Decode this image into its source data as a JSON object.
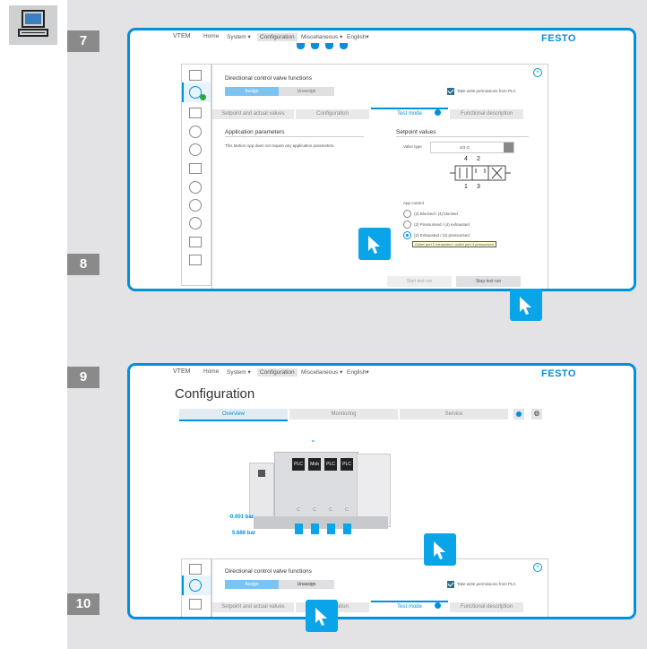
{
  "steps": [
    "7",
    "8",
    "9",
    "10"
  ],
  "nav": {
    "app_title": "VTEM",
    "items": [
      "Home",
      "System ▾",
      "Configuration",
      "Miscellaneous ▾",
      "English▾"
    ],
    "brand": "FESTO"
  },
  "panel": {
    "title": "Directional control valve functions",
    "seg_left": "Assign",
    "seg_right": "Unassign",
    "permissions": "Take write permissions from PLC",
    "tabs": [
      "Setpoint and actual values",
      "Configuration",
      "Test mode",
      "Functional description"
    ],
    "app_params_title": "Application parameters",
    "app_params_text": "This Motion App does not require any application parameters.",
    "setpoint_title": "Setpoint values",
    "valve_type_label": "Valve type",
    "valve_type_value": "4/3 G",
    "port_labels": [
      "4",
      "2",
      "1",
      "3"
    ],
    "app_control_label": "App control",
    "options": [
      "(2) Blocked / (4) blocked",
      "(2) Pressurised / (4) exhausted",
      "(2) Exhausted / (4) pressurised"
    ],
    "tooltip": "Outlet port 2 exhausted / outlet port 4 pressurised",
    "start_btn": "Start test run",
    "stop_btn": "Stop test run"
  },
  "config": {
    "title": "Configuration",
    "tabs": [
      "Overview",
      "Monitoring",
      "Service"
    ],
    "module_labels": [
      "PLC",
      "Mob",
      "PLC",
      "PLC"
    ],
    "module_sub": [
      "C",
      "C",
      "C",
      "C"
    ],
    "pressure1": "-0.001 bar",
    "pressure2": "5.666 bar"
  },
  "colors": {
    "accent": "#0091dc",
    "step_bg": "#8a8a8a",
    "page_bg": "#e3e3e5"
  }
}
